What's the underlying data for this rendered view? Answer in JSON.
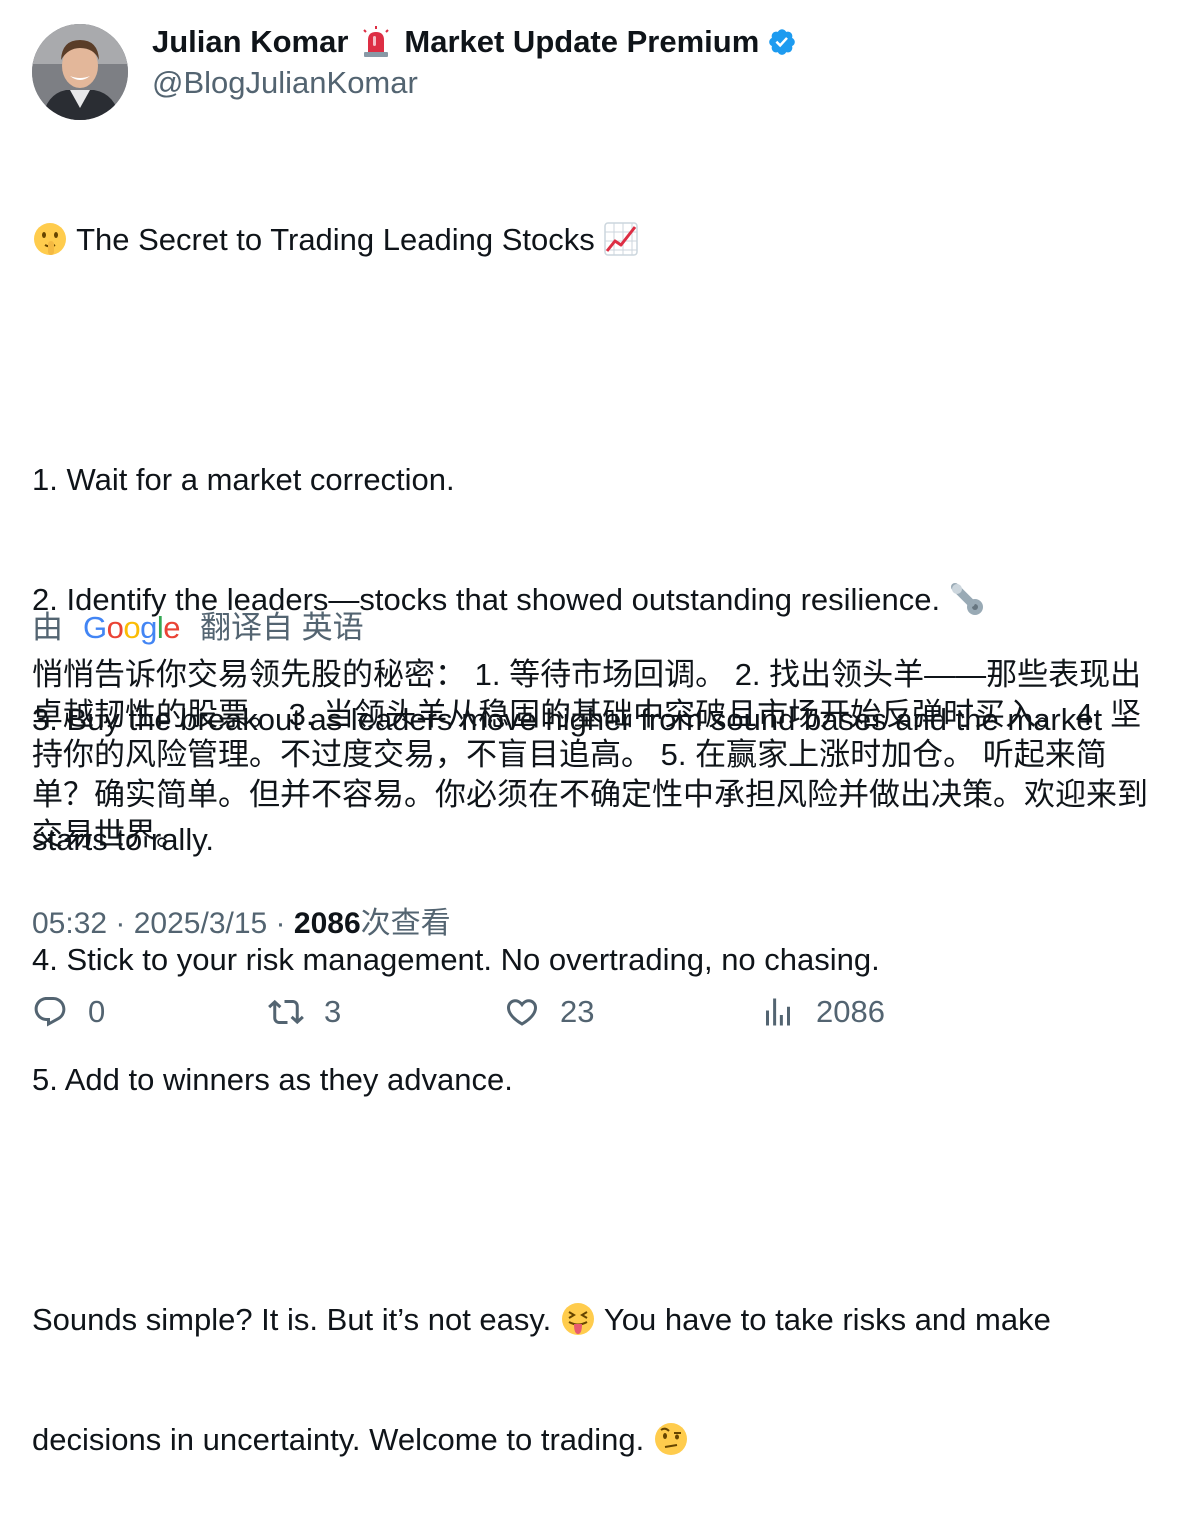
{
  "author": {
    "name_part1": "Julian Komar",
    "name_part2": "Market Update Premium",
    "handle": "@BlogJulianKomar",
    "verified": true,
    "verified_color": "#1d9bf0"
  },
  "tweet": {
    "title": "The Secret to Trading Leading Stocks",
    "item1": "1. Wait for a market correction.",
    "item2": "2. Identify the leaders—stocks that showed outstanding resilience.",
    "item3a": "3. Buy the breakout as leaders move higher from sound bases and the market",
    "item3b": "starts to rally.",
    "item4": "4. Stick to your risk management. No overtrading, no chasing.",
    "item5": "5. Add to winners as they advance.",
    "closing1a": "Sounds simple? It is. But it’s not easy.",
    "closing1b": "You have to take risks and make",
    "closing2": "decisions in uncertainty. Welcome to trading."
  },
  "translation_bar": {
    "prefix": "由",
    "provider": "Google",
    "suffix": "翻译自 英语"
  },
  "translation": {
    "text": "悄悄告诉你交易领先股的秘密： 1. 等待市场回调。 2. 找出领头羊——那些表现出卓越韧性的股票。 3. 当领头羊从稳固的基础中突破且市场开始反弹时买入。 4. 坚持你的风险管理。不过度交易，不盲目追高。 5. 在赢家上涨时加仓。 听起来简单？确实简单。但并不容易。你必须在不确定性中承担风险并做出决策。欢迎来到交易世界。"
  },
  "meta": {
    "time": "05:32",
    "sep1": " · ",
    "date": "2025/3/15",
    "sep2": " · ",
    "views": "2086",
    "views_label": "次查看"
  },
  "actions": {
    "replies": "0",
    "retweets": "3",
    "likes": "23",
    "views": "2086"
  },
  "icons": {
    "shush": "shushing-face-emoji",
    "chart": "chart-increasing-emoji",
    "arm": "mechanical-arm-emoji",
    "tongue": "squinting-face-with-tongue-emoji",
    "raised_eyebrow": "face-with-raised-eyebrow-emoji",
    "beacon": "police-light-emoji"
  },
  "colors": {
    "text": "#0f1419",
    "secondary": "#536471",
    "accent": "#1d9bf0"
  }
}
